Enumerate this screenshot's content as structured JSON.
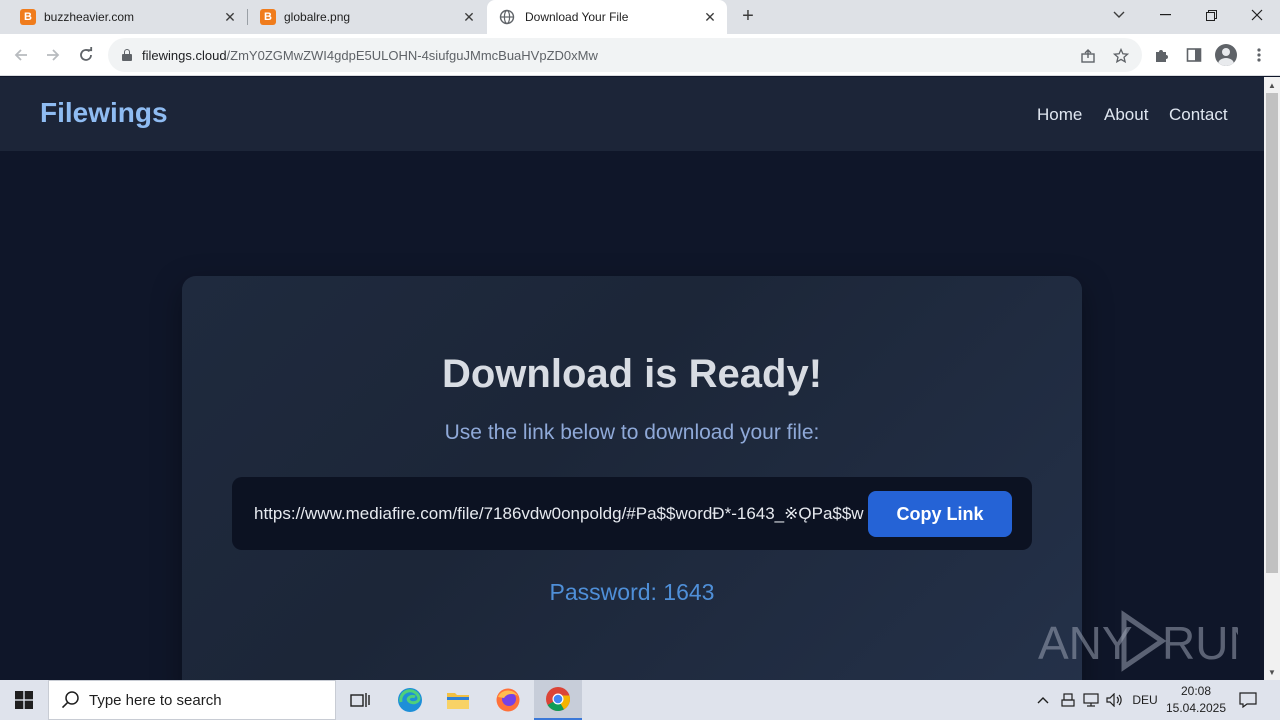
{
  "browser": {
    "tabs": [
      {
        "title": "buzzheavier.com",
        "favicon": "blogger-b-icon",
        "favicon_letter": "B"
      },
      {
        "title": "globalre.png",
        "favicon": "blogger-b-icon",
        "favicon_letter": "B"
      },
      {
        "title": "Download Your File",
        "favicon": "globe-icon",
        "active": true
      }
    ],
    "address": {
      "domain": "filewings.cloud",
      "path": "/ZmY0ZGMwZWI4gdpE5ULOHN-4siufguJMmcBuaHVpZD0xMw"
    }
  },
  "site": {
    "brand": "Filewings",
    "nav": [
      "Home",
      "About",
      "Contact"
    ],
    "colors": {
      "brand": "#8fbcf2",
      "accent": "#2563d6",
      "background": "#0f1629"
    }
  },
  "card": {
    "title": "Download is Ready!",
    "subtitle": "Use the link below to download your file:",
    "link": "https://www.mediafire.com/file/7186vdw0onpoldg/#Pa$$wordÐ*-1643_※ǪPa$$w",
    "copy_label": "Copy Link",
    "password_label": "Password:",
    "password_value": "1643"
  },
  "watermark": {
    "text_left": "ANY",
    "text_right": "RUN"
  },
  "taskbar": {
    "search_placeholder": "Type here to search",
    "language": "DEU",
    "time": "20:08",
    "date": "15.04.2025"
  }
}
